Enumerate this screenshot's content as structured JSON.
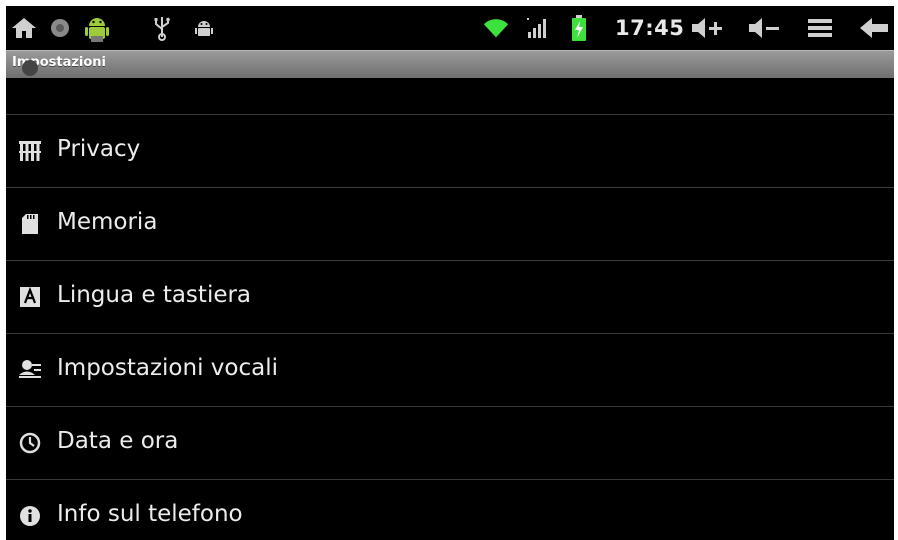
{
  "status_bar": {
    "clock": "17:45",
    "left_icons": [
      "home-icon",
      "notification-dot-icon",
      "android-app-icon",
      "usb-icon",
      "android-debug-icon"
    ],
    "right_icons": [
      "wifi-icon",
      "signal-icon",
      "battery-charging-icon",
      "volume-up-icon",
      "volume-down-icon",
      "menu-icon",
      "back-icon"
    ],
    "wifi_color": "#3ee03e",
    "battery_color": "#3ee03e"
  },
  "title_bar": {
    "title": "Impostazioni"
  },
  "settings": {
    "items": [
      {
        "label": "Privacy",
        "icon": "privacy-icon"
      },
      {
        "label": "Memoria",
        "icon": "sd-card-icon"
      },
      {
        "label": "Lingua e tastiera",
        "icon": "language-keyboard-icon"
      },
      {
        "label": "Impostazioni vocali",
        "icon": "voice-settings-icon"
      },
      {
        "label": "Data e ora",
        "icon": "clock-icon"
      },
      {
        "label": "Info sul telefono",
        "icon": "info-icon"
      }
    ]
  }
}
